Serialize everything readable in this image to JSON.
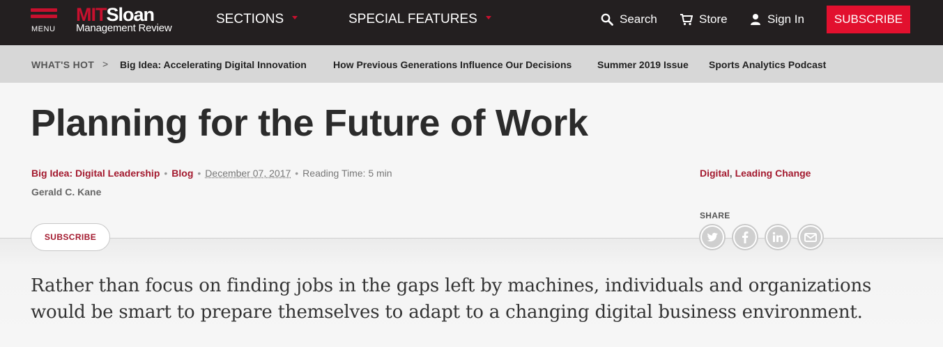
{
  "header": {
    "menu_label": "MENU",
    "logo_mit": "MIT",
    "logo_sloan": "Sloan",
    "logo_sub": "Management Review",
    "nav": [
      {
        "label": "SECTIONS"
      },
      {
        "label": "SPECIAL FEATURES"
      }
    ],
    "search_label": "Search",
    "store_label": "Store",
    "signin_label": "Sign In",
    "subscribe_label": "SUBSCRIBE",
    "accent_color": "#c8102e"
  },
  "whats_hot": {
    "label": "WHAT'S HOT",
    "separator": ">",
    "links": [
      "Big Idea: Accelerating Digital Innovation",
      "How Previous Generations Influence Our Decisions",
      "Summer 2019 Issue",
      "Sports Analytics Podcast"
    ]
  },
  "article": {
    "title": "Planning for the Future of Work",
    "category": "Big Idea: Digital Leadership",
    "type": "Blog",
    "date": "December 07, 2017",
    "reading_time": "Reading Time: 5 min",
    "author": "Gerald C. Kane",
    "topics": [
      "Digital",
      "Leading Change"
    ],
    "topics_separator": ",",
    "share_label": "SHARE",
    "share_icons": [
      "twitter-icon",
      "facebook-icon",
      "linkedin-icon",
      "email-icon"
    ],
    "subscribe_label": "SUBSCRIBE",
    "dek": "Rather than focus on finding jobs in the gaps left by machines, individuals and organizations would be smart to prepare themselves to adapt to a changing digital business environment."
  }
}
